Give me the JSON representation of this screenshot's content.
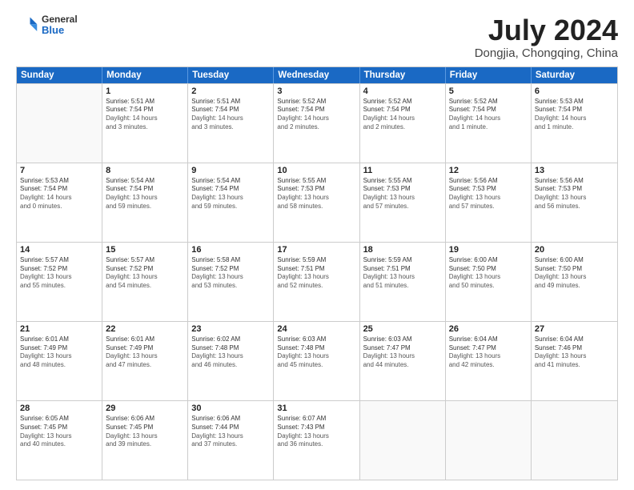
{
  "header": {
    "logo_general": "General",
    "logo_blue": "Blue",
    "month": "July 2024",
    "location": "Dongjia, Chongqing, China"
  },
  "weekdays": [
    "Sunday",
    "Monday",
    "Tuesday",
    "Wednesday",
    "Thursday",
    "Friday",
    "Saturday"
  ],
  "rows": [
    [
      {
        "day": "",
        "lines": []
      },
      {
        "day": "1",
        "lines": [
          "Sunrise: 5:51 AM",
          "Sunset: 7:54 PM",
          "Daylight: 14 hours",
          "and 3 minutes."
        ]
      },
      {
        "day": "2",
        "lines": [
          "Sunrise: 5:51 AM",
          "Sunset: 7:54 PM",
          "Daylight: 14 hours",
          "and 3 minutes."
        ]
      },
      {
        "day": "3",
        "lines": [
          "Sunrise: 5:52 AM",
          "Sunset: 7:54 PM",
          "Daylight: 14 hours",
          "and 2 minutes."
        ]
      },
      {
        "day": "4",
        "lines": [
          "Sunrise: 5:52 AM",
          "Sunset: 7:54 PM",
          "Daylight: 14 hours",
          "and 2 minutes."
        ]
      },
      {
        "day": "5",
        "lines": [
          "Sunrise: 5:52 AM",
          "Sunset: 7:54 PM",
          "Daylight: 14 hours",
          "and 1 minute."
        ]
      },
      {
        "day": "6",
        "lines": [
          "Sunrise: 5:53 AM",
          "Sunset: 7:54 PM",
          "Daylight: 14 hours",
          "and 1 minute."
        ]
      }
    ],
    [
      {
        "day": "7",
        "lines": [
          "Sunrise: 5:53 AM",
          "Sunset: 7:54 PM",
          "Daylight: 14 hours",
          "and 0 minutes."
        ]
      },
      {
        "day": "8",
        "lines": [
          "Sunrise: 5:54 AM",
          "Sunset: 7:54 PM",
          "Daylight: 13 hours",
          "and 59 minutes."
        ]
      },
      {
        "day": "9",
        "lines": [
          "Sunrise: 5:54 AM",
          "Sunset: 7:54 PM",
          "Daylight: 13 hours",
          "and 59 minutes."
        ]
      },
      {
        "day": "10",
        "lines": [
          "Sunrise: 5:55 AM",
          "Sunset: 7:53 PM",
          "Daylight: 13 hours",
          "and 58 minutes."
        ]
      },
      {
        "day": "11",
        "lines": [
          "Sunrise: 5:55 AM",
          "Sunset: 7:53 PM",
          "Daylight: 13 hours",
          "and 57 minutes."
        ]
      },
      {
        "day": "12",
        "lines": [
          "Sunrise: 5:56 AM",
          "Sunset: 7:53 PM",
          "Daylight: 13 hours",
          "and 57 minutes."
        ]
      },
      {
        "day": "13",
        "lines": [
          "Sunrise: 5:56 AM",
          "Sunset: 7:53 PM",
          "Daylight: 13 hours",
          "and 56 minutes."
        ]
      }
    ],
    [
      {
        "day": "14",
        "lines": [
          "Sunrise: 5:57 AM",
          "Sunset: 7:52 PM",
          "Daylight: 13 hours",
          "and 55 minutes."
        ]
      },
      {
        "day": "15",
        "lines": [
          "Sunrise: 5:57 AM",
          "Sunset: 7:52 PM",
          "Daylight: 13 hours",
          "and 54 minutes."
        ]
      },
      {
        "day": "16",
        "lines": [
          "Sunrise: 5:58 AM",
          "Sunset: 7:52 PM",
          "Daylight: 13 hours",
          "and 53 minutes."
        ]
      },
      {
        "day": "17",
        "lines": [
          "Sunrise: 5:59 AM",
          "Sunset: 7:51 PM",
          "Daylight: 13 hours",
          "and 52 minutes."
        ]
      },
      {
        "day": "18",
        "lines": [
          "Sunrise: 5:59 AM",
          "Sunset: 7:51 PM",
          "Daylight: 13 hours",
          "and 51 minutes."
        ]
      },
      {
        "day": "19",
        "lines": [
          "Sunrise: 6:00 AM",
          "Sunset: 7:50 PM",
          "Daylight: 13 hours",
          "and 50 minutes."
        ]
      },
      {
        "day": "20",
        "lines": [
          "Sunrise: 6:00 AM",
          "Sunset: 7:50 PM",
          "Daylight: 13 hours",
          "and 49 minutes."
        ]
      }
    ],
    [
      {
        "day": "21",
        "lines": [
          "Sunrise: 6:01 AM",
          "Sunset: 7:49 PM",
          "Daylight: 13 hours",
          "and 48 minutes."
        ]
      },
      {
        "day": "22",
        "lines": [
          "Sunrise: 6:01 AM",
          "Sunset: 7:49 PM",
          "Daylight: 13 hours",
          "and 47 minutes."
        ]
      },
      {
        "day": "23",
        "lines": [
          "Sunrise: 6:02 AM",
          "Sunset: 7:48 PM",
          "Daylight: 13 hours",
          "and 46 minutes."
        ]
      },
      {
        "day": "24",
        "lines": [
          "Sunrise: 6:03 AM",
          "Sunset: 7:48 PM",
          "Daylight: 13 hours",
          "and 45 minutes."
        ]
      },
      {
        "day": "25",
        "lines": [
          "Sunrise: 6:03 AM",
          "Sunset: 7:47 PM",
          "Daylight: 13 hours",
          "and 44 minutes."
        ]
      },
      {
        "day": "26",
        "lines": [
          "Sunrise: 6:04 AM",
          "Sunset: 7:47 PM",
          "Daylight: 13 hours",
          "and 42 minutes."
        ]
      },
      {
        "day": "27",
        "lines": [
          "Sunrise: 6:04 AM",
          "Sunset: 7:46 PM",
          "Daylight: 13 hours",
          "and 41 minutes."
        ]
      }
    ],
    [
      {
        "day": "28",
        "lines": [
          "Sunrise: 6:05 AM",
          "Sunset: 7:45 PM",
          "Daylight: 13 hours",
          "and 40 minutes."
        ]
      },
      {
        "day": "29",
        "lines": [
          "Sunrise: 6:06 AM",
          "Sunset: 7:45 PM",
          "Daylight: 13 hours",
          "and 39 minutes."
        ]
      },
      {
        "day": "30",
        "lines": [
          "Sunrise: 6:06 AM",
          "Sunset: 7:44 PM",
          "Daylight: 13 hours",
          "and 37 minutes."
        ]
      },
      {
        "day": "31",
        "lines": [
          "Sunrise: 6:07 AM",
          "Sunset: 7:43 PM",
          "Daylight: 13 hours",
          "and 36 minutes."
        ]
      },
      {
        "day": "",
        "lines": []
      },
      {
        "day": "",
        "lines": []
      },
      {
        "day": "",
        "lines": []
      }
    ]
  ]
}
